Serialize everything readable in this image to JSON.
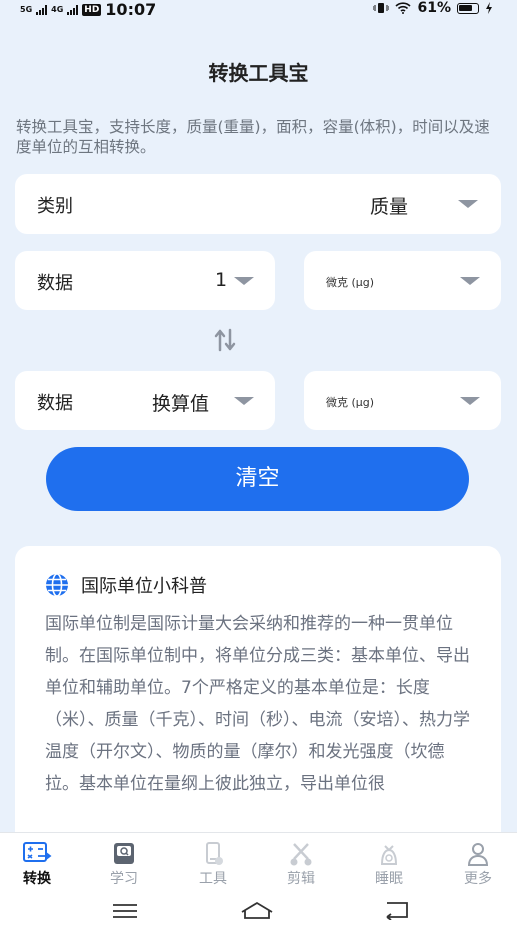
{
  "status_bar": {
    "sim1": "5G",
    "sim2": "4G",
    "hd": "HD",
    "time": "10:07",
    "battery": "61%"
  },
  "title": "转换工具宝",
  "description": "转换工具宝，支持长度，质量(重量)，面积，容量(体积)，时间以及速度单位的互相转换。",
  "category": {
    "label": "类别",
    "value": "质量"
  },
  "input": {
    "label": "数据",
    "value": "1",
    "unit": "微克 (µg)"
  },
  "output": {
    "label": "数据",
    "value": "换算值",
    "unit": "微克 (µg)"
  },
  "clear_button": "清空",
  "info": {
    "title": "国际单位小科普",
    "body": "国际单位制是国际计量大会采纳和推荐的一种一贯单位制。在国际单位制中，将单位分成三类：基本单位、导出单位和辅助单位。7个严格定义的基本单位是：长度（米）、质量（千克）、时间（秒）、电流（安培）、热力学温度（开尔文）、物质的量（摩尔）和发光强度（坎德拉。基本单位在量纲上彼此独立，导出单位很"
  },
  "tabs": [
    {
      "label": "转换",
      "icon": "convert-icon",
      "active": true
    },
    {
      "label": "学习",
      "icon": "study-icon",
      "active": false
    },
    {
      "label": "工具",
      "icon": "tools-icon",
      "active": false
    },
    {
      "label": "剪辑",
      "icon": "scissors-icon",
      "active": false
    },
    {
      "label": "睡眠",
      "icon": "sleep-icon",
      "active": false
    },
    {
      "label": "更多",
      "icon": "person-icon",
      "active": false
    }
  ],
  "colors": {
    "accent": "#1f6fee",
    "background": "#e9f1fb"
  }
}
